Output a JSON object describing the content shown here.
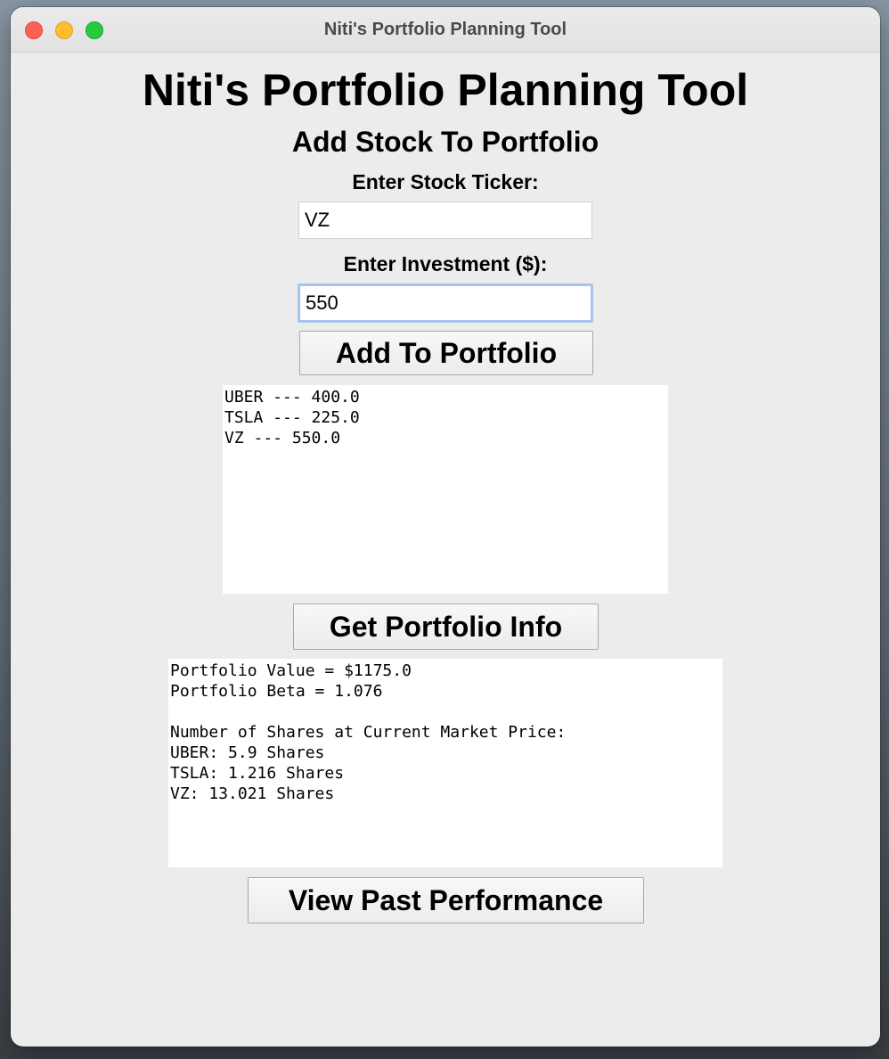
{
  "window": {
    "title": "Niti's Portfolio Planning Tool"
  },
  "app": {
    "heading": "Niti's Portfolio Planning Tool",
    "section_title": "Add Stock To Portfolio",
    "ticker_label": "Enter Stock Ticker:",
    "ticker_value": "VZ",
    "investment_label": "Enter Investment ($):",
    "investment_value": "550",
    "add_button": "Add To Portfolio",
    "holdings": [
      "UBER --- 400.0",
      "TSLA --- 225.0",
      "VZ --- 550.0"
    ],
    "info_button": "Get Portfolio Info",
    "info_lines": [
      "Portfolio Value = $1175.0",
      "Portfolio Beta = 1.076",
      "",
      "Number of Shares at Current Market Price:",
      "UBER: 5.9 Shares",
      "TSLA: 1.216 Shares",
      "VZ: 13.021 Shares"
    ],
    "past_button": "View Past Performance"
  }
}
